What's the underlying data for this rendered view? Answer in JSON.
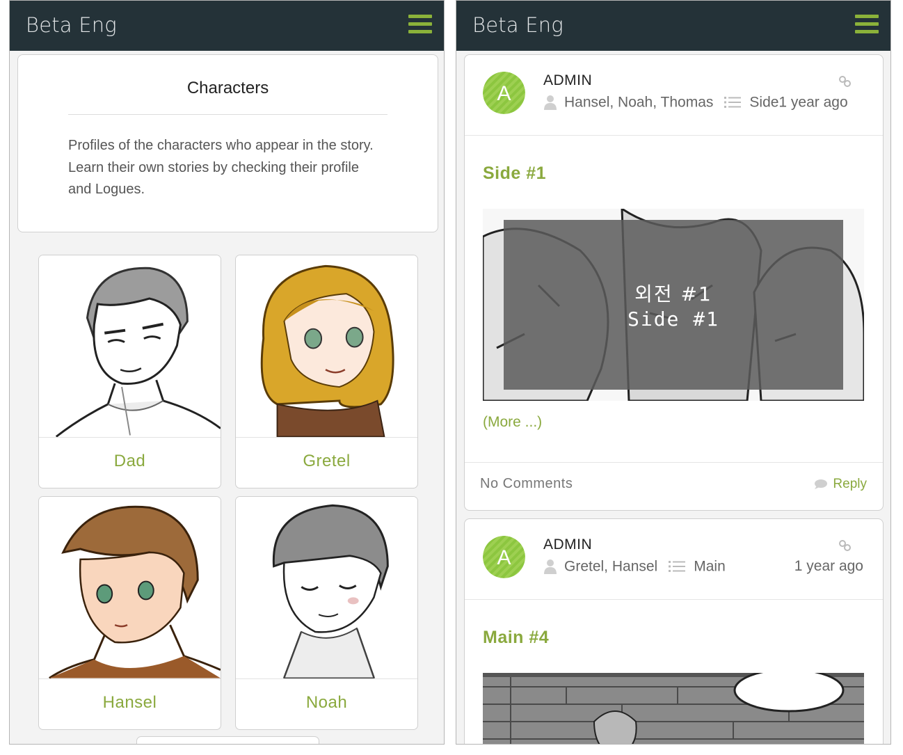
{
  "left_screen": {
    "app_title": "Beta Eng",
    "intro": {
      "title": "Characters",
      "description": "Profiles of the characters who appear in the story. Learn their own stories by checking their profile and Logues."
    },
    "characters": [
      {
        "name": "Dad"
      },
      {
        "name": "Gretel"
      },
      {
        "name": "Hansel"
      },
      {
        "name": "Noah"
      }
    ]
  },
  "right_screen": {
    "app_title": "Beta Eng",
    "posts": [
      {
        "avatar_letter": "A",
        "author": "ADMIN",
        "characters": "Hansel, Noah, Thomas",
        "category_time": "Side1 year ago",
        "title": "Side #1",
        "image_text_line1": "외전 #1",
        "image_text_line2": "Side #1",
        "more": "(More ...)",
        "comments": "No Comments",
        "reply": "Reply"
      },
      {
        "avatar_letter": "A",
        "author": "ADMIN",
        "characters": "Gretel, Hansel",
        "category": "Main",
        "time": "1 year ago",
        "title": "Main #4"
      }
    ]
  },
  "colors": {
    "topbar": "#243238",
    "accent_green": "#8aa93e",
    "menu_green": "#8bb23a",
    "avatar_green": "#8cc63f"
  },
  "icons": [
    "menu-icon",
    "link-icon",
    "person-icon",
    "list-icon",
    "comment-bubble-icon"
  ]
}
